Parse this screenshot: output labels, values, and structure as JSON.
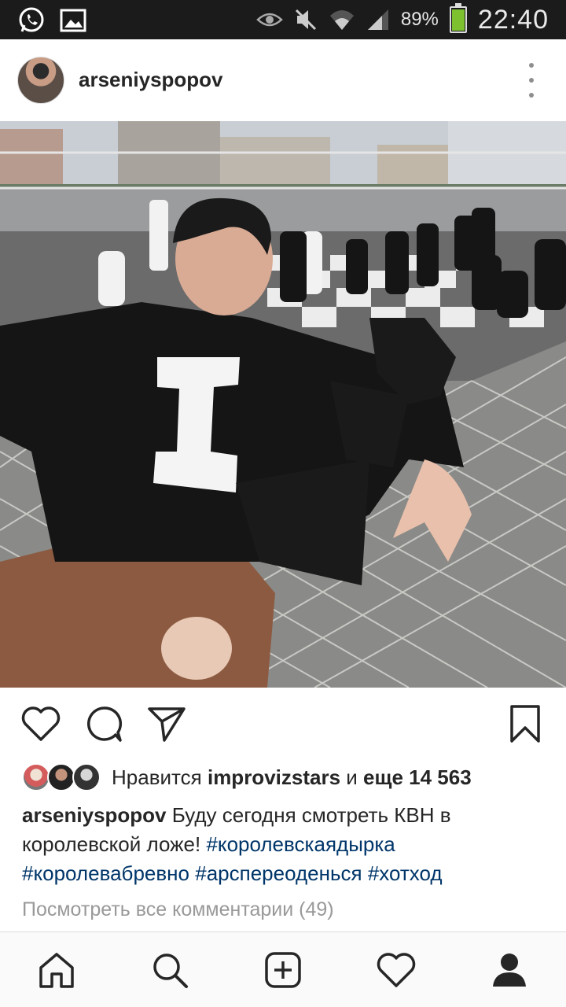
{
  "status_bar": {
    "battery_percent": "89%",
    "battery_level": 0.89,
    "time": "22:40",
    "left_icons": [
      "whatsapp-icon",
      "gallery-icon"
    ],
    "right_icons": [
      "eye-icon",
      "mute-icon",
      "wifi-icon",
      "signal-icon",
      "battery-icon"
    ]
  },
  "post": {
    "username": "arseniyspopov",
    "photo_description_icon": "photo",
    "likes": {
      "prefix": "Нравится",
      "liker": "improvizstars",
      "conjunction": "и",
      "more": "еще 14 563"
    },
    "caption": {
      "author": "arseniyspopov",
      "text": "Буду сегодня смотреть КВН в королевской ложе!",
      "hashtags": [
        "#королевскаядырка",
        "#королевабревно",
        "#арспереоденься",
        "#хотход"
      ]
    },
    "view_comments": "Посмотреть все комментарии (49)"
  },
  "actions": [
    "heart-icon",
    "comment-icon",
    "share-icon",
    "bookmark-icon"
  ],
  "bottom_nav": [
    "home-icon",
    "search-icon",
    "add-post-icon",
    "activity-icon",
    "profile-icon"
  ],
  "colors": {
    "status_bar_bg": "#1b1b1b",
    "text": "#262626",
    "hashtag": "#003569",
    "muted": "#999999",
    "battery_green": "#7ec12e"
  }
}
